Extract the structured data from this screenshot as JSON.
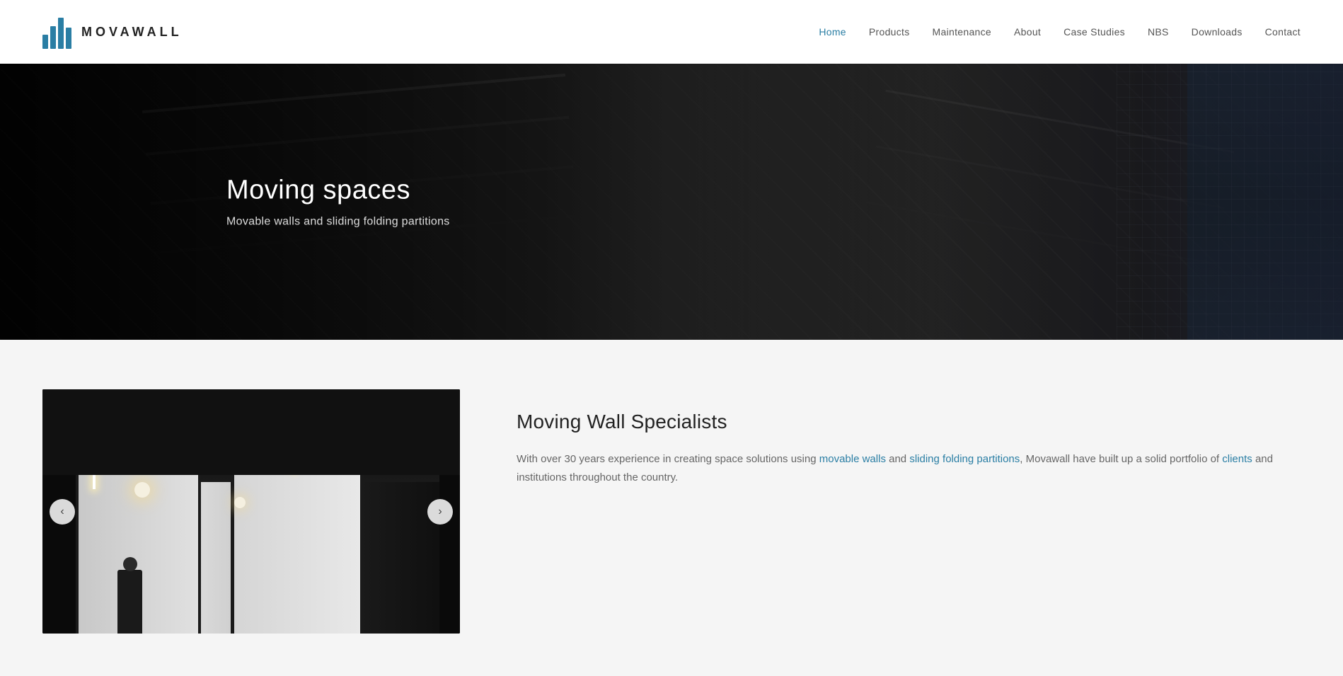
{
  "header": {
    "logo_text": "MOVAWALL",
    "nav_items": [
      {
        "label": "Home",
        "active": true,
        "href": "#"
      },
      {
        "label": "Products",
        "active": false,
        "href": "#"
      },
      {
        "label": "Maintenance",
        "active": false,
        "href": "#"
      },
      {
        "label": "About",
        "active": false,
        "href": "#"
      },
      {
        "label": "Case Studies",
        "active": false,
        "href": "#"
      },
      {
        "label": "NBS",
        "active": false,
        "href": "#"
      },
      {
        "label": "Downloads",
        "active": false,
        "href": "#"
      },
      {
        "label": "Contact",
        "active": false,
        "href": "#"
      }
    ]
  },
  "hero": {
    "title": "Moving spaces",
    "subtitle": "Movable walls and sliding folding partitions"
  },
  "content": {
    "section_title": "Moving Wall Specialists",
    "section_body_line1": "With over 30 years experience in creating space solutions using movable walls and sliding folding partitions, Movawall have built up a solid portfolio of clients and institutions throughout the country.",
    "arrow_left": "‹",
    "arrow_right": "›"
  }
}
